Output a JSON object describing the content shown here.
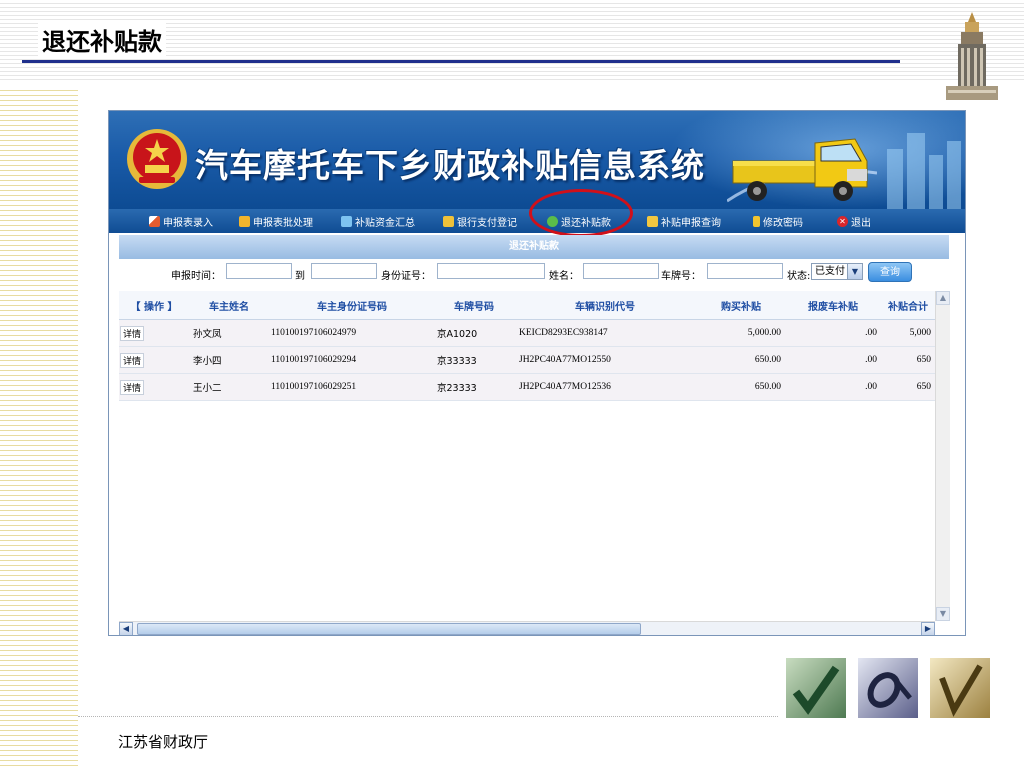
{
  "slide": {
    "title": "退还补贴款",
    "footer": "江苏省财政厅"
  },
  "app": {
    "title": "汽车摩托车下乡财政补贴信息系统",
    "menu": [
      {
        "label": "申报表录入",
        "icon": "pen-icon"
      },
      {
        "label": "申报表批处理",
        "icon": "batch-icon"
      },
      {
        "label": "补贴资金汇总",
        "icon": "checklist-icon"
      },
      {
        "label": "银行支付登记",
        "icon": "coins-icon"
      },
      {
        "label": "退还补贴款",
        "icon": "refund-icon"
      },
      {
        "label": "补贴申报查询",
        "icon": "search-icon"
      },
      {
        "label": "修改密码",
        "icon": "key-icon"
      },
      {
        "label": "退出",
        "icon": "close-icon"
      }
    ],
    "panel_title": "退还补贴款",
    "search": {
      "date_label": "申报时间：",
      "to_label": "到",
      "id_label": "身份证号：",
      "name_label": "姓名：",
      "plate_label": "车牌号：",
      "status_label": "状态:",
      "status_value": "已支付",
      "query_button": "查询"
    },
    "table": {
      "columns": [
        "【 操作 】",
        "车主姓名",
        "车主身份证号码",
        "车牌号码",
        "车辆识别代号",
        "购买补贴",
        "报废车补贴",
        "补贴合计"
      ],
      "rows": [
        {
          "action": "详情",
          "name": "孙文凤",
          "id": "110100197106024979",
          "plate": "京A1020",
          "vin": "KEICD8293EC938147",
          "purchase": "5,000.00",
          "scrap": ".00",
          "total": "5,000"
        },
        {
          "action": "详情",
          "name": "李小四",
          "id": "110100197106029294",
          "plate": "京33333",
          "vin": "JH2PC40A77MO12550",
          "purchase": "650.00",
          "scrap": ".00",
          "total": "650"
        },
        {
          "action": "详情",
          "name": "王小二",
          "id": "110100197106029251",
          "plate": "京23333",
          "vin": "JH2PC40A77MO12536",
          "purchase": "650.00",
          "scrap": ".00",
          "total": "650"
        }
      ]
    }
  },
  "colors": {
    "banner": "#1a5ba8",
    "highlight": "#d0101a",
    "title_rule": "#1f2f8c",
    "header_text": "#1f4ea3"
  }
}
